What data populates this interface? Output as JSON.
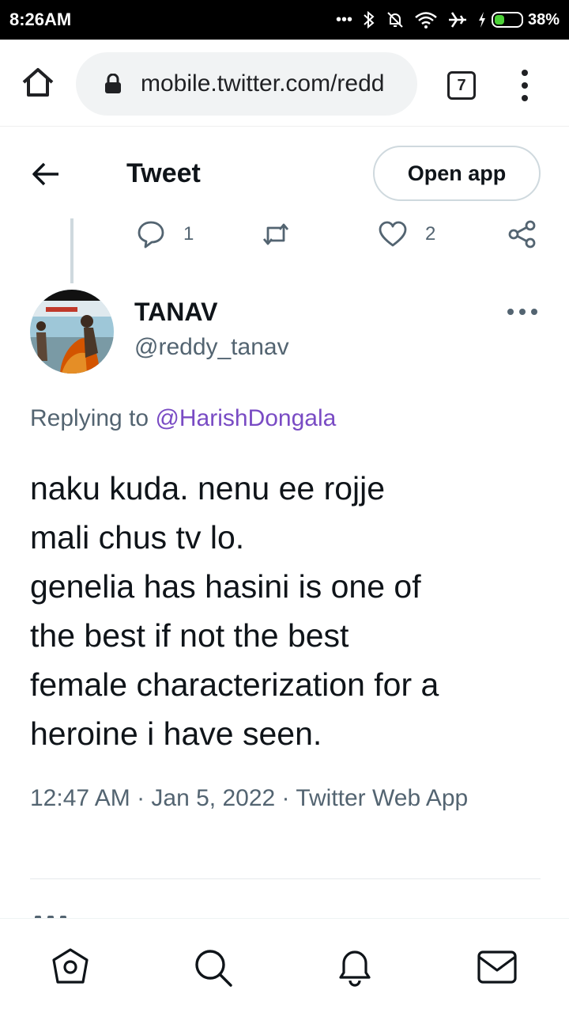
{
  "status_bar": {
    "time": "8:26AM",
    "battery_percent": "38%",
    "battery_level": 0.38,
    "icons": [
      "more-dots-icon",
      "bluetooth-icon",
      "bell-off-icon",
      "wifi-icon",
      "airplane-icon",
      "charging-icon",
      "battery-icon"
    ]
  },
  "browser": {
    "url": "mobile.twitter.com/redd",
    "tab_count": "7"
  },
  "header": {
    "title": "Tweet",
    "open_app_label": "Open app"
  },
  "parent_actions": {
    "reply_count": "1",
    "like_count": "2"
  },
  "tweet": {
    "display_name": "TANAV",
    "handle": "@reddy_tanav",
    "replying_prefix": "Replying to ",
    "replying_to": "@HarishDongala",
    "text": "naku kuda. nenu ee rojje\nmali chus tv lo.\ngenelia has hasini is one of\nthe best if not the best\nfemale characterization for a\nheroine i have seen.",
    "meta": "12:47 AM · Jan 5, 2022 · Twitter Web App"
  },
  "colors": {
    "accent_mention": "#794bc4",
    "secondary_text": "#536471",
    "battery_fill": "#4cd137"
  }
}
